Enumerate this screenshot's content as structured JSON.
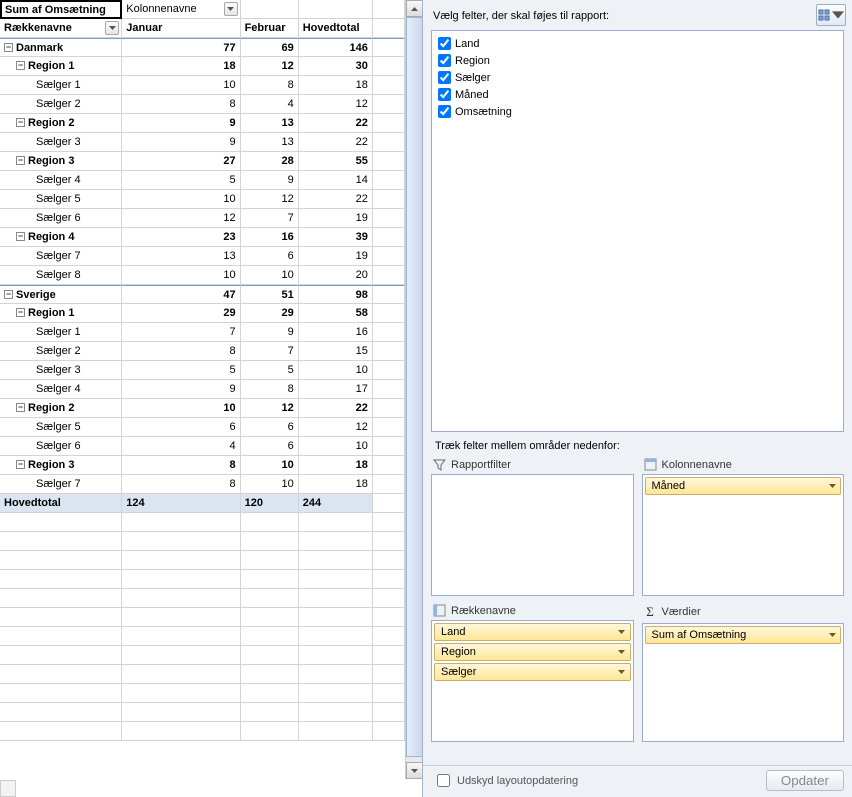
{
  "pivot": {
    "top_left_cell": "Sum af Omsætning",
    "column_drop_label": "Kolonnenavne",
    "row_drop_label": "Rækkenavne",
    "columns": {
      "jan": "Januar",
      "feb": "Februar",
      "total": "Hovedtotal"
    },
    "rows": [
      {
        "label": "Danmark",
        "lvl": 0,
        "exp": true,
        "bold": true,
        "jan": 77,
        "feb": 69,
        "tot": 146,
        "country": true
      },
      {
        "label": "Region 1",
        "lvl": 1,
        "exp": true,
        "bold": true,
        "jan": 18,
        "feb": 12,
        "tot": 30
      },
      {
        "label": "Sælger 1",
        "lvl": 2,
        "jan": 10,
        "feb": 8,
        "tot": 18
      },
      {
        "label": "Sælger 2",
        "lvl": 2,
        "jan": 8,
        "feb": 4,
        "tot": 12
      },
      {
        "label": "Region 2",
        "lvl": 1,
        "exp": true,
        "bold": true,
        "jan": 9,
        "feb": 13,
        "tot": 22
      },
      {
        "label": "Sælger 3",
        "lvl": 2,
        "jan": 9,
        "feb": 13,
        "tot": 22
      },
      {
        "label": "Region 3",
        "lvl": 1,
        "exp": true,
        "bold": true,
        "jan": 27,
        "feb": 28,
        "tot": 55
      },
      {
        "label": "Sælger 4",
        "lvl": 2,
        "jan": 5,
        "feb": 9,
        "tot": 14
      },
      {
        "label": "Sælger 5",
        "lvl": 2,
        "jan": 10,
        "feb": 12,
        "tot": 22
      },
      {
        "label": "Sælger 6",
        "lvl": 2,
        "jan": 12,
        "feb": 7,
        "tot": 19
      },
      {
        "label": "Region 4",
        "lvl": 1,
        "exp": true,
        "bold": true,
        "jan": 23,
        "feb": 16,
        "tot": 39
      },
      {
        "label": "Sælger 7",
        "lvl": 2,
        "jan": 13,
        "feb": 6,
        "tot": 19
      },
      {
        "label": "Sælger 8",
        "lvl": 2,
        "jan": 10,
        "feb": 10,
        "tot": 20
      },
      {
        "label": "Sverige",
        "lvl": 0,
        "exp": true,
        "bold": true,
        "jan": 47,
        "feb": 51,
        "tot": 98,
        "country": true
      },
      {
        "label": "Region 1",
        "lvl": 1,
        "exp": true,
        "bold": true,
        "jan": 29,
        "feb": 29,
        "tot": 58
      },
      {
        "label": "Sælger 1",
        "lvl": 2,
        "jan": 7,
        "feb": 9,
        "tot": 16
      },
      {
        "label": "Sælger 2",
        "lvl": 2,
        "jan": 8,
        "feb": 7,
        "tot": 15
      },
      {
        "label": "Sælger 3",
        "lvl": 2,
        "jan": 5,
        "feb": 5,
        "tot": 10
      },
      {
        "label": "Sælger 4",
        "lvl": 2,
        "jan": 9,
        "feb": 8,
        "tot": 17
      },
      {
        "label": "Region 2",
        "lvl": 1,
        "exp": true,
        "bold": true,
        "jan": 10,
        "feb": 12,
        "tot": 22
      },
      {
        "label": "Sælger 5",
        "lvl": 2,
        "jan": 6,
        "feb": 6,
        "tot": 12
      },
      {
        "label": "Sælger 6",
        "lvl": 2,
        "jan": 4,
        "feb": 6,
        "tot": 10
      },
      {
        "label": "Region 3",
        "lvl": 1,
        "exp": true,
        "bold": true,
        "jan": 8,
        "feb": 10,
        "tot": 18
      },
      {
        "label": "Sælger 7",
        "lvl": 2,
        "jan": 8,
        "feb": 10,
        "tot": 18
      }
    ],
    "grand": {
      "label": "Hovedtotal",
      "jan": 124,
      "feb": 120,
      "tot": 244
    }
  },
  "panel": {
    "choose_label": "Vælg felter, der skal føjes til rapport:",
    "fields": [
      "Land",
      "Region",
      "Sælger",
      "Måned",
      "Omsætning"
    ],
    "drag_label": "Træk felter mellem områder nedenfor:",
    "areas": {
      "filter": {
        "title": "Rapportfilter",
        "items": []
      },
      "columns": {
        "title": "Kolonnenavne",
        "items": [
          "Måned"
        ]
      },
      "rows": {
        "title": "Rækkenavne",
        "items": [
          "Land",
          "Region",
          "Sælger"
        ]
      },
      "values": {
        "title": "Værdier",
        "items": [
          "Sum af Omsætning"
        ]
      }
    },
    "defer_label": "Udskyd layoutopdatering",
    "update_label": "Opdater"
  }
}
